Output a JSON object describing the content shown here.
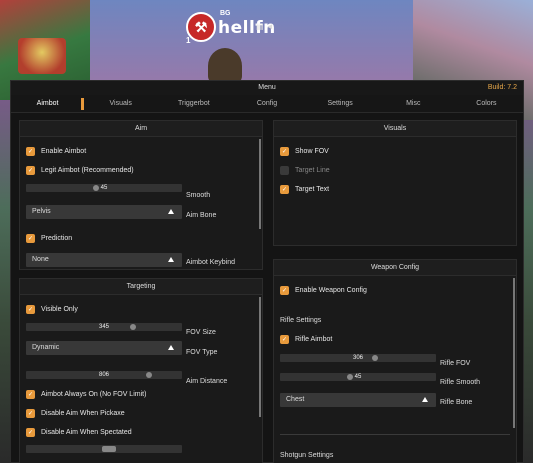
{
  "logo": {
    "small_text": "BG",
    "text": "hellfn",
    "number": "1",
    "icons": "▤ ◄"
  },
  "menu": {
    "title": "Menu",
    "build": "Build: 7.2"
  },
  "tabs": [
    {
      "label": "Aimbot",
      "active": true
    },
    {
      "label": "Visuals"
    },
    {
      "label": "Triggerbot"
    },
    {
      "label": "Config"
    },
    {
      "label": "Settings"
    },
    {
      "label": "Misc"
    },
    {
      "label": "Colors"
    }
  ],
  "aim": {
    "title": "Aim",
    "enable_aimbot": "Enable Aimbot",
    "legit_aimbot": "Legit Aimbot (Recommended)",
    "smooth_value": "45",
    "smooth_label": "Smooth",
    "aim_bone_value": "Pelvis",
    "aim_bone_label": "Aim Bone",
    "prediction": "Prediction",
    "keybind_value": "None",
    "keybind_label": "Aimbot Keybind"
  },
  "targeting": {
    "title": "Targeting",
    "visible_only": "Visible Only",
    "fov_size_value": "345",
    "fov_size_label": "FOV Size",
    "fov_type_value": "Dynamic",
    "fov_type_label": "FOV Type",
    "aim_distance_value": "806",
    "aim_distance_label": "Aim Distance",
    "always_on": "Aimbot Always On (No FOV Limit)",
    "disable_pickaxe": "Disable Aim When Pickaxe",
    "disable_spectated": "Disable Aim When Spectated"
  },
  "visuals": {
    "title": "Visuals",
    "show_fov": "Show FOV",
    "target_line": "Target Line",
    "target_text": "Target Text"
  },
  "weapon": {
    "title": "Weapon Config",
    "enable": "Enable Weapon Config",
    "rifle_settings": "Rifle Settings",
    "rifle_aimbot": "Rifle Aimbot",
    "rifle_fov_value": "306",
    "rifle_fov_label": "Rifle FOV",
    "rifle_smooth_value": "45",
    "rifle_smooth_label": "Rifle Smooth",
    "rifle_bone_value": "Chest",
    "rifle_bone_label": "Rifle Bone",
    "shotgun_settings": "Shotgun Settings"
  },
  "colors": {
    "accent": "#e89a3c",
    "panel": "#1a1a1a",
    "background": "#141414"
  }
}
